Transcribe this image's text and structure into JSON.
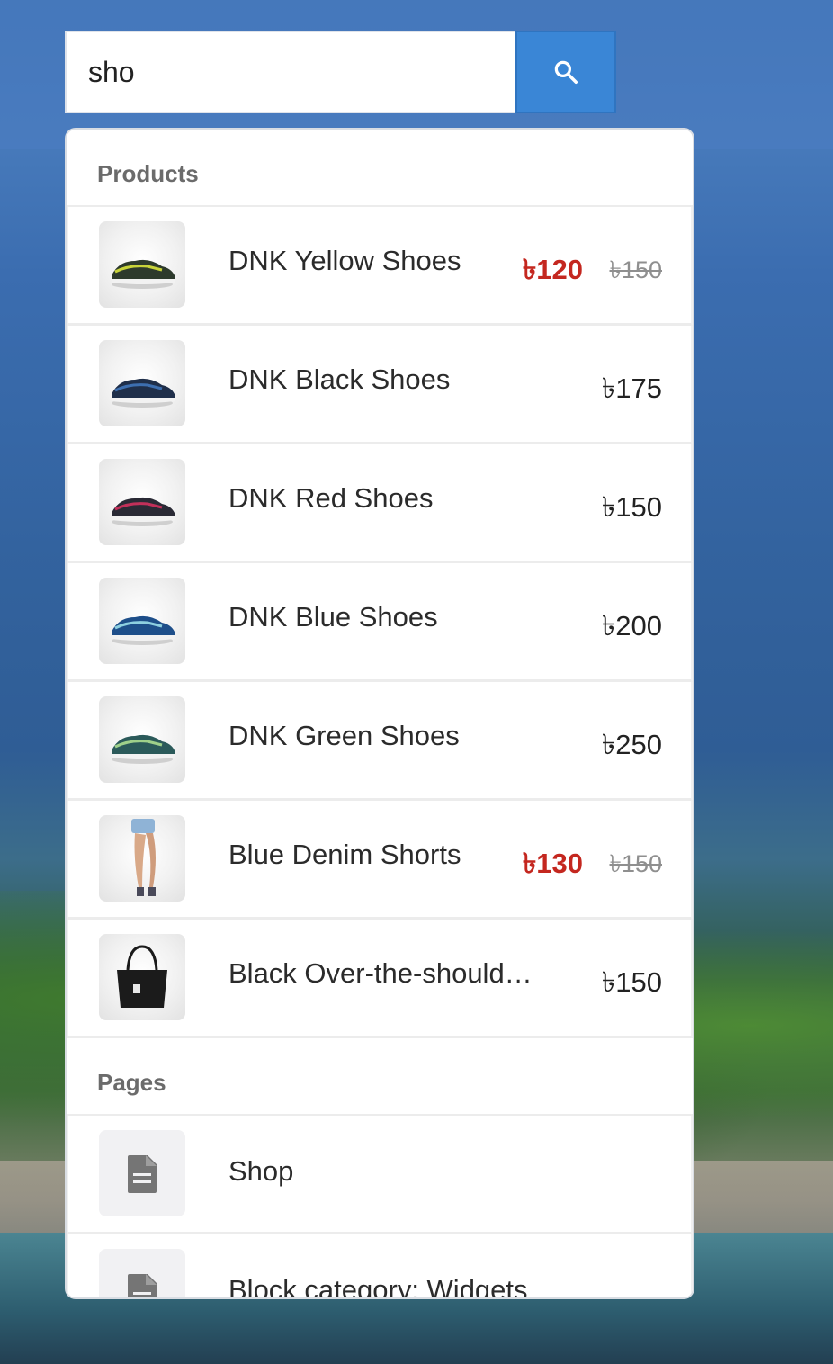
{
  "search": {
    "value": "sho",
    "button_icon": "search-icon"
  },
  "dropdown": {
    "products_header": "Products",
    "products": [
      {
        "title": "DNK Yellow Shoes",
        "sale_price": "৳120",
        "regular_price": "৳150",
        "image": "shoe-yellow-green"
      },
      {
        "title": "DNK Black Shoes",
        "price": "৳175",
        "image": "shoe-black-blue"
      },
      {
        "title": "DNK Red Shoes",
        "price": "৳150",
        "image": "shoe-red"
      },
      {
        "title": "DNK Blue Shoes",
        "price": "৳200",
        "image": "shoe-blue"
      },
      {
        "title": "DNK Green Shoes",
        "price": "৳250",
        "image": "shoe-green"
      },
      {
        "title": "Blue Denim Shorts",
        "sale_price": "৳130",
        "regular_price": "৳150",
        "image": "denim-shorts"
      },
      {
        "title": "Black Over-the-should…",
        "price": "৳150",
        "image": "black-handbag"
      }
    ],
    "pages_header": "Pages",
    "pages": [
      {
        "title": "Shop",
        "icon": "document-icon"
      },
      {
        "title": "Block category: Widgets",
        "icon": "document-icon"
      }
    ]
  },
  "colors": {
    "search_button": "#3a86d6",
    "sale_price": "#c4271f",
    "old_price": "#8f8f8f",
    "section_header": "#6b6b6b"
  }
}
